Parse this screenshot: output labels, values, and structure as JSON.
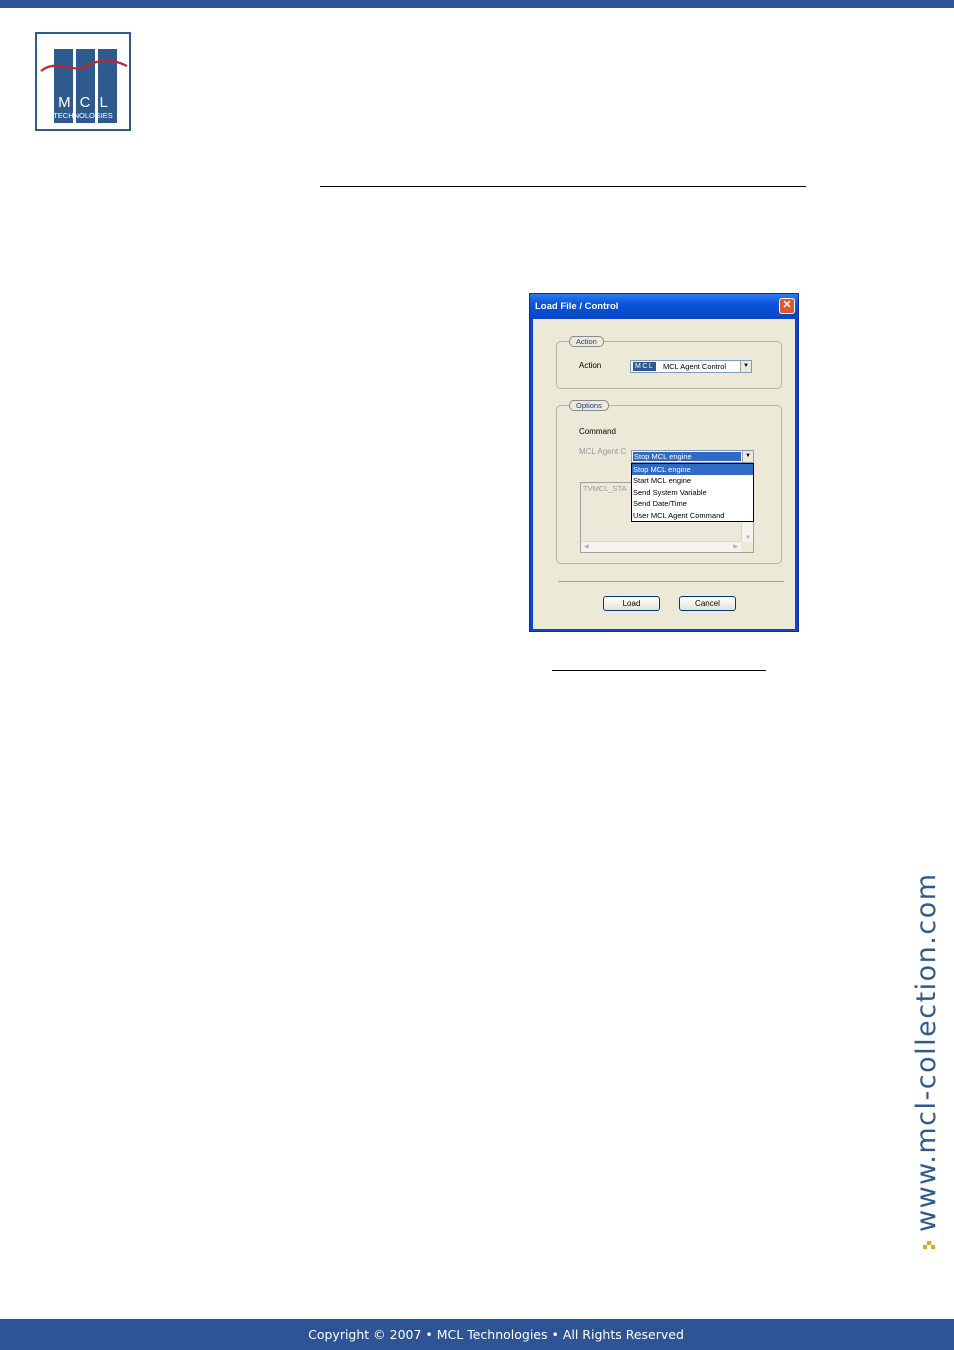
{
  "logo": {
    "letters": "MCL",
    "subtitle": "TECHNOLOGIES"
  },
  "dialog": {
    "title": "Load File / Control",
    "close_glyph": "✕",
    "action_group": {
      "label": "Action",
      "field_label": "Action",
      "badge": "MCL",
      "value": "MCL Agent Control"
    },
    "options_group": {
      "label": "Options",
      "command_label": "Command",
      "command_value": "Stop MCL engine",
      "command_options": [
        "Stop MCL engine",
        "Start MCL engine",
        "Send System Variable",
        "Send Date/Time",
        "User MCL Agent Command"
      ],
      "agent_label": "MCL Agent C",
      "agent_text": "TVMCL_STA"
    },
    "buttons": {
      "load": "Load",
      "cancel": "Cancel"
    }
  },
  "sidebar": {
    "url": "www.mcl-collection.com"
  },
  "footer": {
    "copyright": "Copyright © 2007 • MCL Technologies • All Rights Reserved"
  },
  "colors": {
    "brand_blue": "#2f5496",
    "accent_orange": "#f0a020"
  }
}
